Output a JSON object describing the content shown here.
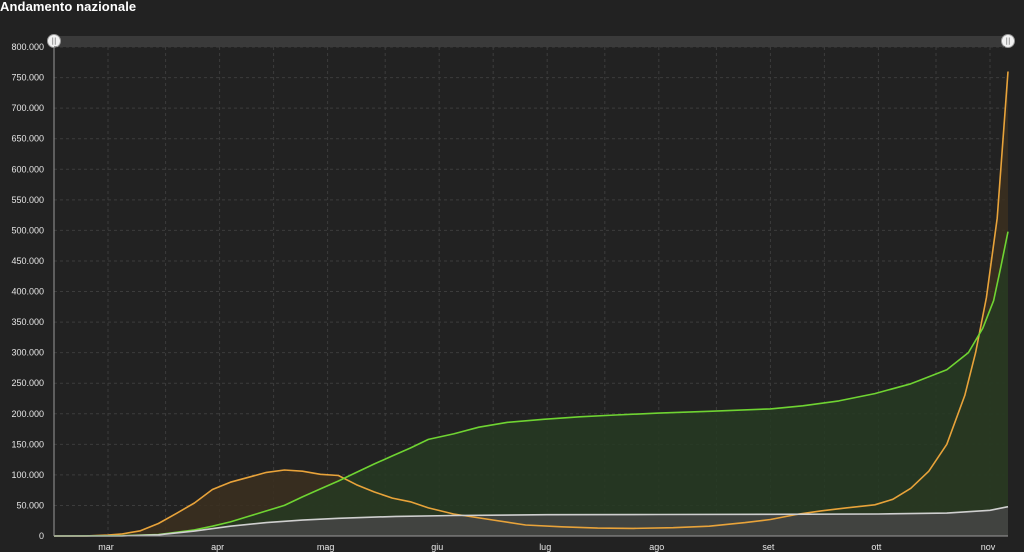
{
  "header": {
    "title": "Andamento nazionale"
  },
  "icons": {
    "range_handle_left": "range-handle-icon",
    "range_handle_right": "range-handle-icon"
  },
  "chart_data": {
    "type": "area",
    "title": "Andamento nazionale",
    "xlabel": "",
    "ylabel": "",
    "ylim": [
      0,
      800000
    ],
    "xlim": [
      "2020-02-15",
      "2020-11-06"
    ],
    "y_ticks": [
      0,
      50000,
      100000,
      150000,
      200000,
      250000,
      300000,
      350000,
      400000,
      450000,
      500000,
      550000,
      600000,
      650000,
      700000,
      750000,
      800000
    ],
    "y_tick_labels": [
      "0",
      "50.000",
      "100.000",
      "150.000",
      "200.000",
      "250.000",
      "300.000",
      "350.000",
      "400.000",
      "450.000",
      "500.000",
      "550.000",
      "600.000",
      "650.000",
      "700.000",
      "750.000",
      "800.000"
    ],
    "x_ticks": [
      "2020-03-01",
      "2020-04-01",
      "2020-05-01",
      "2020-06-01",
      "2020-07-01",
      "2020-08-01",
      "2020-09-01",
      "2020-10-01",
      "2020-11-01"
    ],
    "x_tick_labels": [
      "mar",
      "apr",
      "mag",
      "giu",
      "lug",
      "ago",
      "set",
      "ott",
      "nov"
    ],
    "grid": true,
    "legend": "none",
    "series": [
      {
        "color": "#e8a33a",
        "fill": "#3b2f1e",
        "points": [
          [
            "2020-02-15",
            0
          ],
          [
            "2020-02-24",
            200
          ],
          [
            "2020-03-01",
            1600
          ],
          [
            "2020-03-05",
            3500
          ],
          [
            "2020-03-10",
            8500
          ],
          [
            "2020-03-15",
            20500
          ],
          [
            "2020-03-20",
            37000
          ],
          [
            "2020-03-25",
            54000
          ],
          [
            "2020-03-30",
            76000
          ],
          [
            "2020-04-04",
            88000
          ],
          [
            "2020-04-09",
            96000
          ],
          [
            "2020-04-14",
            104000
          ],
          [
            "2020-04-19",
            108000
          ],
          [
            "2020-04-24",
            106000
          ],
          [
            "2020-04-29",
            101000
          ],
          [
            "2020-05-04",
            99000
          ],
          [
            "2020-05-09",
            84000
          ],
          [
            "2020-05-14",
            72000
          ],
          [
            "2020-05-19",
            62000
          ],
          [
            "2020-05-24",
            56000
          ],
          [
            "2020-05-29",
            46000
          ],
          [
            "2020-06-05",
            36000
          ],
          [
            "2020-06-15",
            27000
          ],
          [
            "2020-06-25",
            18000
          ],
          [
            "2020-07-05",
            15000
          ],
          [
            "2020-07-15",
            13000
          ],
          [
            "2020-07-25",
            12500
          ],
          [
            "2020-08-05",
            13500
          ],
          [
            "2020-08-15",
            16000
          ],
          [
            "2020-08-25",
            22000
          ],
          [
            "2020-09-01",
            27000
          ],
          [
            "2020-09-08",
            35000
          ],
          [
            "2020-09-15",
            41000
          ],
          [
            "2020-09-22",
            46000
          ],
          [
            "2020-09-30",
            51000
          ],
          [
            "2020-10-05",
            60000
          ],
          [
            "2020-10-10",
            78000
          ],
          [
            "2020-10-15",
            106000
          ],
          [
            "2020-10-20",
            150000
          ],
          [
            "2020-10-25",
            230000
          ],
          [
            "2020-10-28",
            300000
          ],
          [
            "2020-10-31",
            390000
          ],
          [
            "2020-11-03",
            520000
          ],
          [
            "2020-11-05",
            680000
          ],
          [
            "2020-11-06",
            760000
          ]
        ]
      },
      {
        "color": "#6fd432",
        "fill": "#263a22",
        "points": [
          [
            "2020-02-15",
            0
          ],
          [
            "2020-03-05",
            500
          ],
          [
            "2020-03-15",
            2500
          ],
          [
            "2020-03-20",
            6000
          ],
          [
            "2020-03-25",
            10000
          ],
          [
            "2020-03-30",
            16000
          ],
          [
            "2020-04-04",
            23000
          ],
          [
            "2020-04-09",
            32000
          ],
          [
            "2020-04-14",
            41000
          ],
          [
            "2020-04-19",
            50000
          ],
          [
            "2020-04-24",
            64000
          ],
          [
            "2020-04-29",
            77000
          ],
          [
            "2020-05-04",
            90000
          ],
          [
            "2020-05-09",
            104000
          ],
          [
            "2020-05-14",
            118000
          ],
          [
            "2020-05-19",
            131000
          ],
          [
            "2020-05-24",
            144000
          ],
          [
            "2020-05-29",
            158000
          ],
          [
            "2020-06-05",
            167000
          ],
          [
            "2020-06-12",
            178000
          ],
          [
            "2020-06-20",
            186000
          ],
          [
            "2020-06-30",
            191000
          ],
          [
            "2020-07-10",
            195000
          ],
          [
            "2020-07-20",
            198000
          ],
          [
            "2020-08-01",
            201000
          ],
          [
            "2020-08-15",
            204000
          ],
          [
            "2020-09-01",
            208000
          ],
          [
            "2020-09-10",
            213000
          ],
          [
            "2020-09-20",
            221000
          ],
          [
            "2020-09-30",
            233000
          ],
          [
            "2020-10-10",
            249000
          ],
          [
            "2020-10-20",
            272000
          ],
          [
            "2020-10-26",
            300000
          ],
          [
            "2020-10-30",
            340000
          ],
          [
            "2020-11-02",
            385000
          ],
          [
            "2020-11-04",
            440000
          ],
          [
            "2020-11-06",
            498000
          ]
        ]
      },
      {
        "color": "#cfcfcf",
        "fill": "#454545",
        "points": [
          [
            "2020-02-15",
            0
          ],
          [
            "2020-03-05",
            200
          ],
          [
            "2020-03-15",
            2000
          ],
          [
            "2020-03-25",
            8000
          ],
          [
            "2020-04-04",
            16000
          ],
          [
            "2020-04-14",
            22000
          ],
          [
            "2020-04-24",
            26000
          ],
          [
            "2020-05-04",
            29000
          ],
          [
            "2020-05-20",
            32000
          ],
          [
            "2020-06-05",
            33500
          ],
          [
            "2020-07-01",
            34800
          ],
          [
            "2020-08-01",
            35200
          ],
          [
            "2020-09-01",
            35500
          ],
          [
            "2020-10-01",
            36000
          ],
          [
            "2020-10-20",
            37500
          ],
          [
            "2020-11-01",
            42000
          ],
          [
            "2020-11-06",
            48000
          ]
        ]
      }
    ]
  }
}
